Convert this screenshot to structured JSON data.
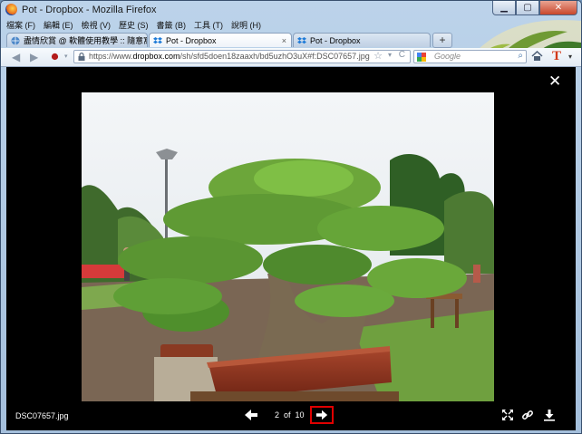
{
  "window": {
    "title": "Pot - Dropbox - Mozilla Firefox",
    "min_icon": "minimize-icon",
    "max_icon": "maximize-icon",
    "close_icon": "close-icon"
  },
  "menu": [
    "檔案 (F)",
    "編輯 (E)",
    "檢視 (V)",
    "歷史 (S)",
    "書籤 (B)",
    "工具 (T)",
    "說明 (H)"
  ],
  "tabs": [
    {
      "label": "盡情欣賞 @ 軟體使用教學 :: 隨意窩 X...",
      "close": "×",
      "active": false
    },
    {
      "label": "Pot - Dropbox",
      "close": "×",
      "active": true
    },
    {
      "label": "Pot - Dropbox",
      "close": "",
      "active": false
    }
  ],
  "new_tab": "+",
  "nav": {
    "back": "◀",
    "forward": "▶",
    "url_prefix": "https://www.",
    "url_domain": "dropbox.com",
    "url_rest": "/sh/sfd5doen18zaaxh/bd5uzhO3uX#f:DSC07657.jpg",
    "star": "☆",
    "dropdown": "▾",
    "reload": "C",
    "search_placeholder": "Google",
    "search_glyph": "⌕",
    "plugin_letter": "T",
    "menu_arrow": "▾"
  },
  "viewer": {
    "close": "✕",
    "filename": "DSC07657.jpg",
    "current": "2",
    "of": "of",
    "total": "10"
  },
  "colors": {
    "accent_highlight": "#e00000",
    "viewer_bg": "#000000"
  }
}
